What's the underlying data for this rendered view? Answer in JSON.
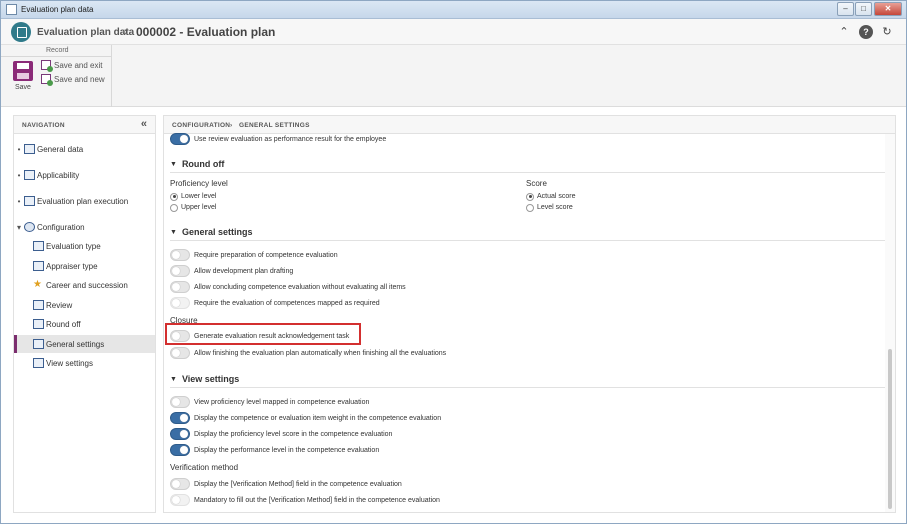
{
  "window": {
    "title": "Evaluation plan data"
  },
  "header": {
    "module": "Evaluation plan data",
    "separator": "›",
    "record": "000002 - Evaluation plan"
  },
  "ribbon": {
    "group_label": "Record",
    "save_label": "Save",
    "save_exit_label": "Save and exit",
    "save_new_label": "Save and new"
  },
  "navigation": {
    "title": "NAVIGATION",
    "collapse_glyph": "«",
    "items": [
      {
        "label": "General data"
      },
      {
        "label": "Applicability"
      },
      {
        "label": "Evaluation plan execution"
      },
      {
        "label": "Configuration"
      },
      {
        "label": "Evaluation type"
      },
      {
        "label": "Appraiser type"
      },
      {
        "label": "Career and succession"
      },
      {
        "label": "Review"
      },
      {
        "label": "Round off"
      },
      {
        "label": "General settings"
      },
      {
        "label": "View settings"
      }
    ]
  },
  "breadcrumb": {
    "part1": "CONFIGURATION",
    "sep": "›",
    "part2": "GENERAL SETTINGS"
  },
  "top_toggle": {
    "label": "Use review evaluation as performance result for the employee",
    "on": true
  },
  "round_off": {
    "title": "Round off",
    "proficiency": {
      "label": "Proficiency level",
      "options": [
        "Lower level",
        "Upper level"
      ],
      "selected": "Lower level"
    },
    "score": {
      "label": "Score",
      "options": [
        "Actual score",
        "Level score"
      ],
      "selected": "Actual score"
    }
  },
  "general_settings": {
    "title": "General settings",
    "toggles": [
      {
        "label": "Require preparation of competence evaluation",
        "on": false
      },
      {
        "label": "Allow development plan drafting",
        "on": false
      },
      {
        "label": "Allow concluding competence evaluation without evaluating all items",
        "on": false
      },
      {
        "label": "Require the evaluation of competences mapped as required",
        "on": false
      }
    ],
    "closure_label": "Closure",
    "closure_toggles": [
      {
        "label": "Generate evaluation result acknowledgement task",
        "on": false
      },
      {
        "label": "Allow finishing the evaluation plan automatically when finishing all the evaluations",
        "on": false
      }
    ]
  },
  "view_settings": {
    "title": "View settings",
    "toggles": [
      {
        "label": "View proficiency level mapped in competence evaluation",
        "on": false
      },
      {
        "label": "Display the competence or evaluation item weight in the competence evaluation",
        "on": true
      },
      {
        "label": "Display the proficiency level score in the competence evaluation",
        "on": true
      },
      {
        "label": "Display the performance level in the competence evaluation",
        "on": true
      }
    ],
    "verification_label": "Verification method",
    "verification_toggles": [
      {
        "label": "Display the [Verification Method] field in the competence evaluation",
        "on": false
      },
      {
        "label": "Mandatory to fill out the [Verification Method] field in the competence evaluation",
        "on": false
      }
    ]
  },
  "colors": {
    "accent": "#7b2d6e",
    "toggle_on": "#3a6ea5",
    "highlight": "#d32f2f"
  }
}
